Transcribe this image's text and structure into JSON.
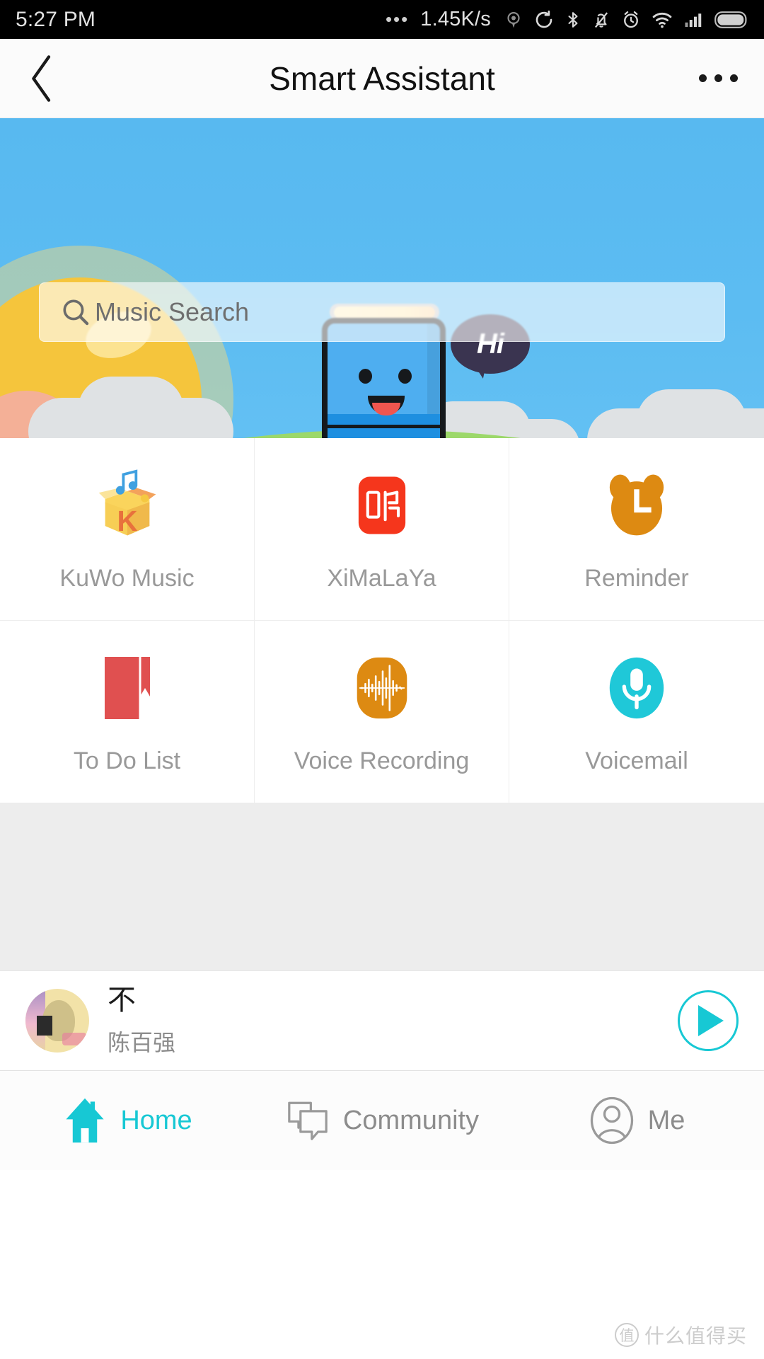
{
  "statusbar": {
    "time": "5:27 PM",
    "dots": "•••",
    "network_speed": "1.45K/s",
    "icons": [
      "vpn-icon",
      "sync-icon",
      "bluetooth-icon",
      "mute-icon",
      "alarm-icon",
      "wifi-icon",
      "signal-icon",
      "battery-icon"
    ]
  },
  "header": {
    "back_label": "",
    "title": "Smart Assistant",
    "more_label": ""
  },
  "banner": {
    "search": {
      "placeholder": "Music Search",
      "value": ""
    },
    "bubble_text": "Hi",
    "mascot": "smart-speaker-mascot"
  },
  "grid": {
    "items": [
      {
        "label": "KuWo Music",
        "icon": "kuwo-music-icon",
        "color": "#F5C842"
      },
      {
        "label": "XiMaLaYa",
        "icon": "ximalaya-icon",
        "color": "#F5361C"
      },
      {
        "label": "Reminder",
        "icon": "alarm-clock-icon",
        "color": "#DD8A12"
      },
      {
        "label": "To Do List",
        "icon": "bookmark-icon",
        "color": "#E05050"
      },
      {
        "label": "Voice Recording",
        "icon": "waveform-icon",
        "color": "#DD8A12"
      },
      {
        "label": "Voicemail",
        "icon": "microphone-icon",
        "color": "#1FC8D8"
      }
    ]
  },
  "player": {
    "title": "不",
    "artist": "陈百强",
    "play_label": "",
    "accent": "#17C8D4"
  },
  "bottom_nav": {
    "items": [
      {
        "label": "Home",
        "icon": "home-icon",
        "active": true
      },
      {
        "label": "Community",
        "icon": "chat-icon",
        "active": false
      },
      {
        "label": "Me",
        "icon": "person-icon",
        "active": false
      }
    ]
  },
  "watermark": {
    "badge": "值",
    "text": "什么值得买"
  }
}
